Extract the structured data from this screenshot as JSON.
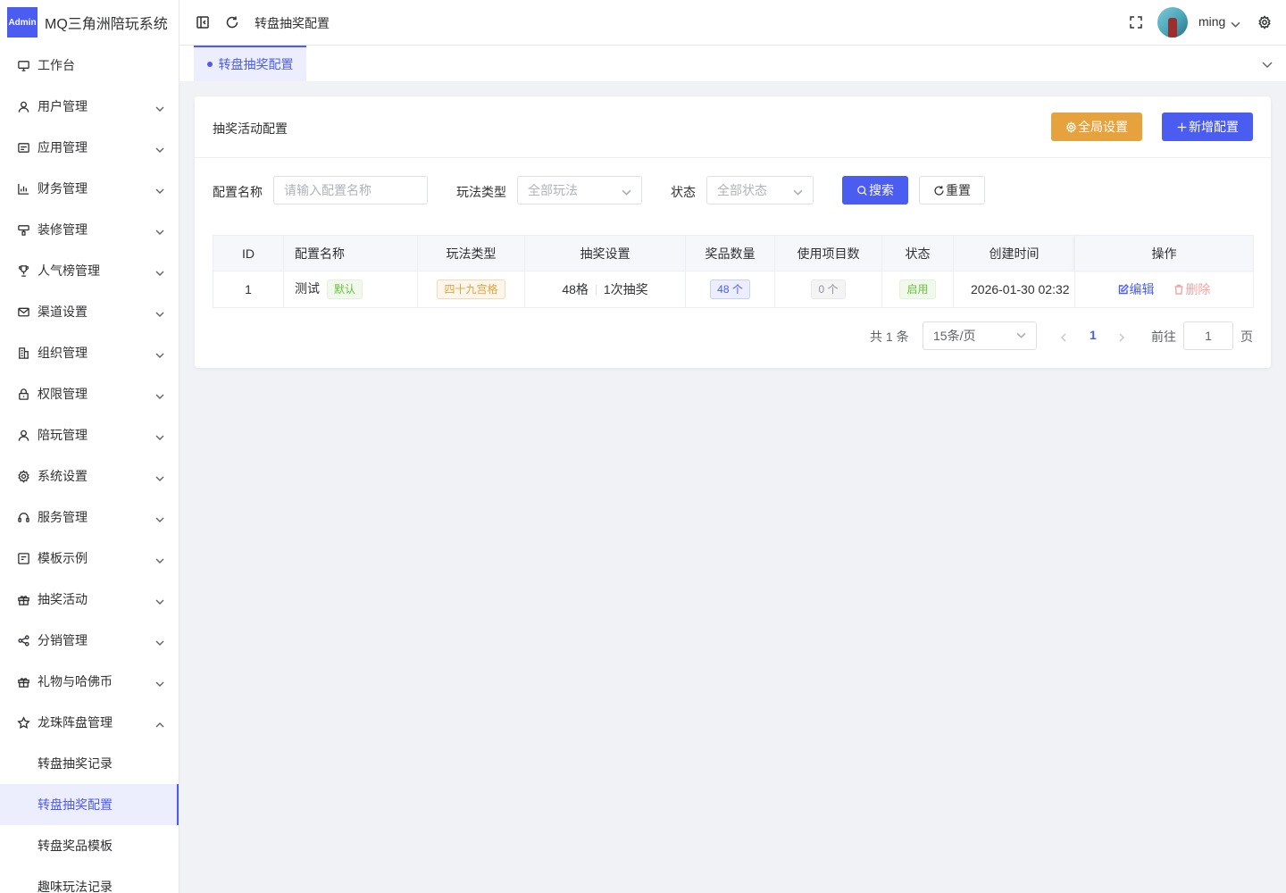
{
  "app": {
    "logo_badge": "Admin",
    "title": "MQ三角洲陪玩系统"
  },
  "sidebar": {
    "items": [
      {
        "label": "工作台",
        "icon": "monitor-icon",
        "expandable": false
      },
      {
        "label": "用户管理",
        "icon": "user-icon",
        "expandable": true
      },
      {
        "label": "应用管理",
        "icon": "app-icon",
        "expandable": true
      },
      {
        "label": "财务管理",
        "icon": "chart-icon",
        "expandable": true
      },
      {
        "label": "装修管理",
        "icon": "brush-icon",
        "expandable": true
      },
      {
        "label": "人气榜管理",
        "icon": "trophy-icon",
        "expandable": true
      },
      {
        "label": "渠道设置",
        "icon": "mail-icon",
        "expandable": true
      },
      {
        "label": "组织管理",
        "icon": "building-icon",
        "expandable": true
      },
      {
        "label": "权限管理",
        "icon": "lock-icon",
        "expandable": true
      },
      {
        "label": "陪玩管理",
        "icon": "person-icon",
        "expandable": true
      },
      {
        "label": "系统设置",
        "icon": "gear-icon",
        "expandable": true
      },
      {
        "label": "服务管理",
        "icon": "headset-icon",
        "expandable": true
      },
      {
        "label": "模板示例",
        "icon": "template-icon",
        "expandable": true
      },
      {
        "label": "抽奖活动",
        "icon": "gift-icon",
        "expandable": true
      },
      {
        "label": "分销管理",
        "icon": "share-icon",
        "expandable": true
      },
      {
        "label": "礼物与哈佛币",
        "icon": "present-icon",
        "expandable": true
      },
      {
        "label": "龙珠阵盘管理",
        "icon": "star-icon",
        "expandable": true,
        "expanded": true
      }
    ],
    "sub_items": [
      {
        "label": "转盘抽奖记录",
        "active": false
      },
      {
        "label": "转盘抽奖配置",
        "active": true
      },
      {
        "label": "转盘奖品模板",
        "active": false
      },
      {
        "label": "趣味玩法记录",
        "active": false
      }
    ]
  },
  "header": {
    "breadcrumb": "转盘抽奖配置",
    "username": "ming"
  },
  "tabs": [
    {
      "label": "转盘抽奖配置",
      "active": true
    }
  ],
  "card": {
    "title": "抽奖活动配置",
    "global_settings_label": "全局设置",
    "add_config_label": "新增配置"
  },
  "filters": {
    "name_label": "配置名称",
    "name_placeholder": "请输入配置名称",
    "play_type_label": "玩法类型",
    "play_type_value": "全部玩法",
    "status_label": "状态",
    "status_value": "全部状态",
    "search_label": "搜索",
    "reset_label": "重置"
  },
  "table": {
    "columns": [
      "ID",
      "配置名称",
      "玩法类型",
      "抽奖设置",
      "奖品数量",
      "使用项目数",
      "状态",
      "创建时间",
      "操作"
    ],
    "rows": [
      {
        "id": "1",
        "name": "测试",
        "default_tag": "默认",
        "play_type": "四十九宫格",
        "grid": "48格",
        "draw": "1次抽奖",
        "prize_count": "48 个",
        "usage_count": "0 个",
        "status": "启用",
        "created": "2026-01-30 02:32",
        "edit_label": "编辑",
        "delete_label": "删除"
      }
    ]
  },
  "pagination": {
    "total": "共 1 条",
    "page_size": "15条/页",
    "current_page": "1",
    "goto_label": "前往",
    "goto_value": "1",
    "page_unit": "页"
  },
  "colors": {
    "primary": "#4b5cf0",
    "warning": "#e6a23c",
    "success": "#67c23a",
    "danger": "#f56c6c"
  }
}
